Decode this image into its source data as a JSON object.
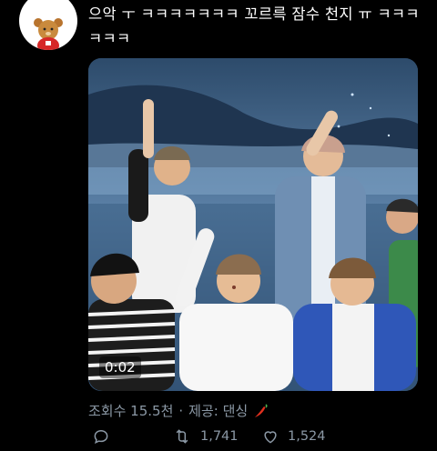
{
  "tweet": {
    "text": "으악 ㅜ ㅋㅋㅋㅋㅋㅋㅋ 꼬르륵 잠수 천지 ㅠ ㅋㅋㅋㅋㅋㅋ",
    "avatar_icon": "teddy-bear-icon",
    "media": {
      "type": "video",
      "duration": "0:02"
    },
    "meta": {
      "views_label": "조회수 15.5천",
      "separator": "·",
      "provider_label": "제공: 댄싱",
      "provider_icon": "chili-pepper-icon"
    },
    "actions": {
      "reply_icon": "reply-icon",
      "retweet_icon": "retweet-icon",
      "retweet_count": "1,741",
      "like_icon": "heart-icon",
      "like_count": "1,524"
    }
  },
  "colors": {
    "background": "#000000",
    "text": "#ffffff",
    "secondary_text": "#8b98a5"
  }
}
